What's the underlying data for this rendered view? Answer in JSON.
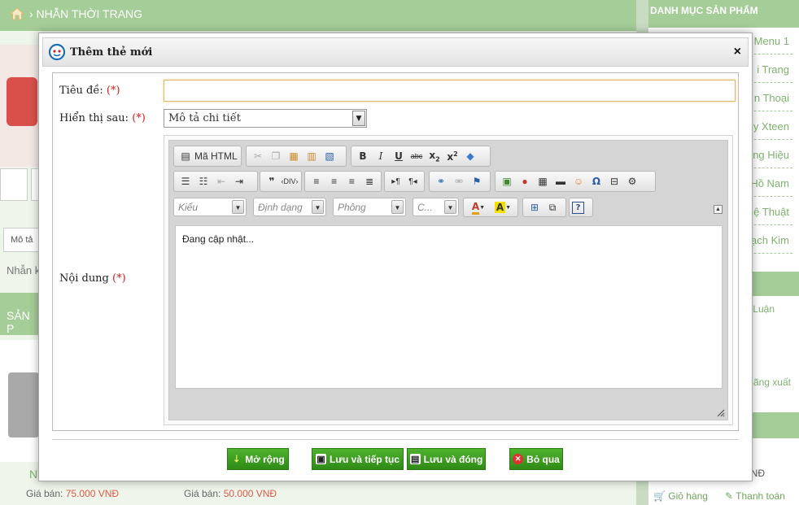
{
  "background": {
    "breadcrumb": "› NHẪN THỜI TRANG",
    "sidebar_heading": "DANH MỤC SẢN PHẨM",
    "sidebar_items": [
      "Menu 1",
      "i Trang",
      "n Thoại",
      "y Xteen",
      "ng Hiệu",
      "Hồ Nam",
      "ệ Thuật",
      "ạch Kim"
    ],
    "sidebar_extra": [
      "Luận",
      "hãng xuất"
    ],
    "sidebar_price_tail": "NĐ",
    "cart_label": "Giỏ hàng",
    "checkout_label": "Thanh toán",
    "tab_label": "Mô tả",
    "desc_text": "Nhẫn k",
    "section_label": "SẢN P",
    "product_letter": "N",
    "price_label": "Giá bán:",
    "prices": [
      "75.000 VNĐ",
      "50.000 VNĐ"
    ]
  },
  "modal": {
    "title": "Thêm thẻ mới",
    "close": "×",
    "fields": {
      "title_label": "Tiêu đề:",
      "title_value": "",
      "display_label": "Hiển thị sau:",
      "display_value": "Mô tả chi tiết",
      "content_label": "Nội dung",
      "required": "(*)"
    },
    "editor": {
      "html_button": "Mã HTML",
      "style_combo": "Kiểu",
      "format_combo": "Định dạng",
      "font_combo": "Phông",
      "size_combo": "C...",
      "content": "Đang cập nhật..."
    },
    "buttons": {
      "expand": "Mở rộng",
      "save_continue": "Lưu và tiếp tục",
      "save_close": "Lưu và đóng",
      "cancel": "Bỏ qua"
    }
  }
}
